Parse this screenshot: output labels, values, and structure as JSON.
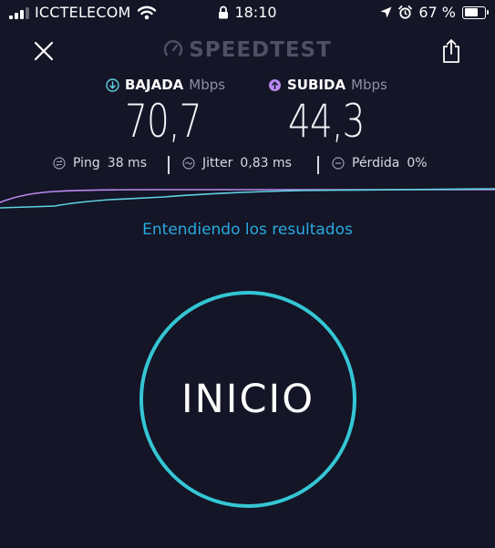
{
  "status_bar": {
    "carrier": "ICCTELECOM",
    "time": "18:10",
    "battery": "67 %",
    "battery_level": 0.67,
    "signal_bars": 3
  },
  "app": {
    "brand": "SPEEDTEST",
    "understand_link": "Entendiendo los resultados",
    "start_button": "INICIO"
  },
  "download": {
    "label": "BAJADA",
    "unit": "Mbps",
    "value": "70,7",
    "color": "#5ed3e0"
  },
  "upload": {
    "label": "SUBIDA",
    "unit": "Mbps",
    "value": "44,3",
    "color": "#b98af0"
  },
  "stats": {
    "ping": {
      "label": "Ping",
      "value": "38 ms"
    },
    "jitter": {
      "label": "Jitter",
      "value": "0,83 ms"
    },
    "loss": {
      "label": "Pérdida",
      "value": "0%"
    }
  },
  "colors": {
    "background": "#141526",
    "accent": "#34c6d4",
    "link": "#28a9e0"
  },
  "icons": [
    "close-icon",
    "gauge-icon",
    "share-icon",
    "download-arrow-icon",
    "upload-arrow-icon",
    "ping-icon",
    "jitter-icon",
    "loss-icon",
    "wifi-icon",
    "lock-icon",
    "location-icon",
    "alarm-icon",
    "battery-icon"
  ]
}
